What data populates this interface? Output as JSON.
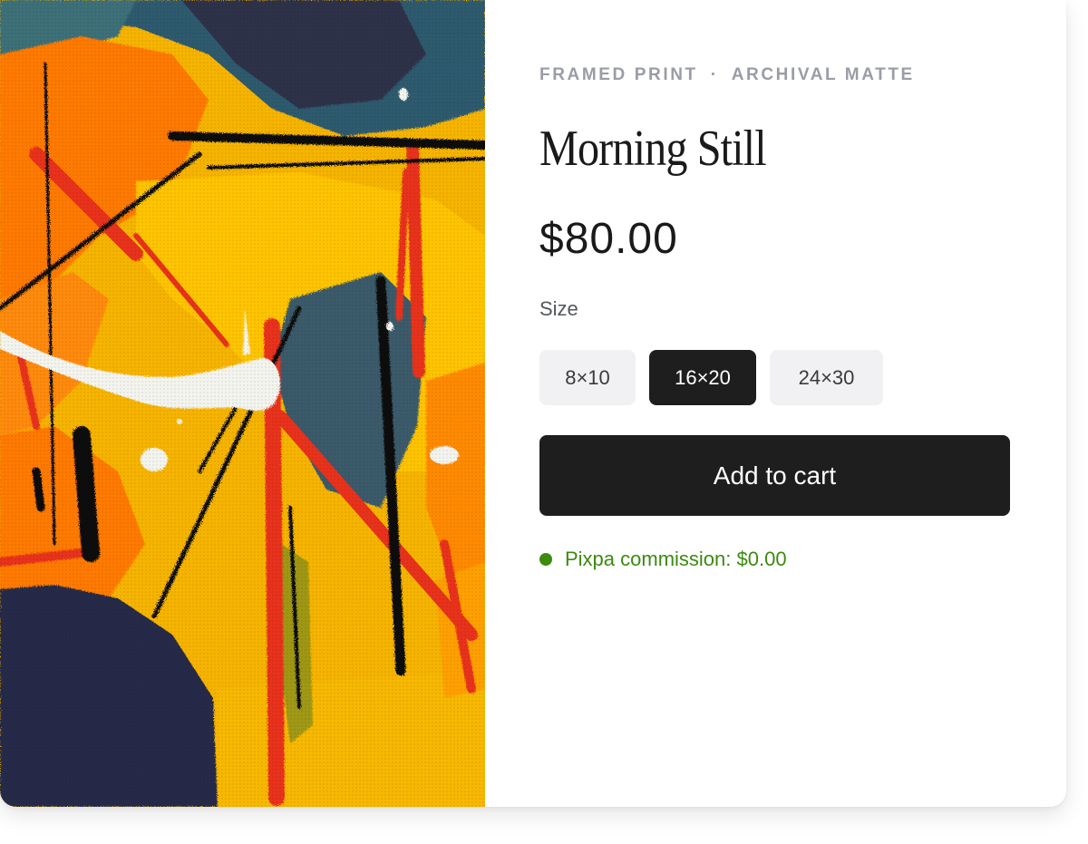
{
  "product": {
    "eyebrow_left": "FRAMED PRINT",
    "eyebrow_separator": "·",
    "eyebrow_right": "ARCHIVAL MATTE",
    "title": "Morning Still",
    "price": "$80.00",
    "size_label": "Size",
    "sizes": [
      "8×10",
      "16×20",
      "24×30"
    ],
    "selected_size": "16×20",
    "add_to_cart_label": "Add to cart",
    "commission_text": "Pixpa commission: $0.00"
  },
  "colors": {
    "accent_dark": "#1e1e1e",
    "size_button_bg": "#f1f1f3",
    "commission_green": "#3c8a10",
    "eyebrow_gray": "#9a9ca6"
  },
  "artwork": {
    "palette": [
      "#f6b400",
      "#ff7a00",
      "#e8321a",
      "#2f5a6e",
      "#262a4a",
      "#111111",
      "#f4f4ef"
    ]
  }
}
